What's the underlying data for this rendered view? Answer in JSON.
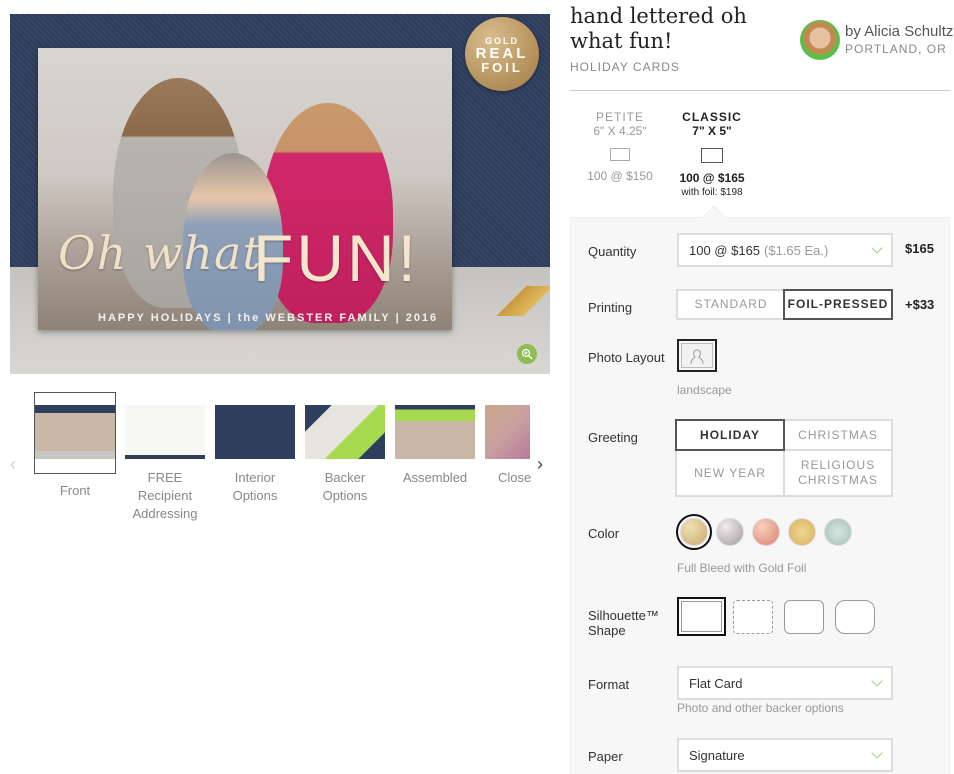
{
  "product": {
    "title": "hand lettered oh what fun!",
    "category": "HOLIDAY CARDS",
    "designer": "by Alicia Schultz",
    "location": "PORTLAND, OR"
  },
  "hero": {
    "badge": [
      "GOLD",
      "REAL",
      "FOIL"
    ],
    "card_script": "Oh what",
    "card_big": "FUN!",
    "card_tagline": "HAPPY HOLIDAYS | the WEBSTER FAMILY | 2016",
    "zoom_icon": "zoom-in-icon"
  },
  "thumbnails": [
    {
      "label": "Front",
      "active": true
    },
    {
      "label": "FREE Recipient Addressing"
    },
    {
      "label": "Interior Options"
    },
    {
      "label": "Backer Options"
    },
    {
      "label": "Assembled"
    },
    {
      "label": "Close"
    }
  ],
  "nav": {
    "prev": "‹",
    "next": "›"
  },
  "sizes": [
    {
      "name": "PETITE",
      "dims": "6\" X 4.25\"",
      "price": "100 @ $150",
      "foil": ""
    },
    {
      "name": "CLASSIC",
      "dims": "7\" X 5\"",
      "price": "100 @ $165",
      "foil": "with foil: $198",
      "selected": true
    }
  ],
  "options": {
    "quantity": {
      "label": "Quantity",
      "value": "100 @ $165",
      "each": "($1.65 Ea.)",
      "price": "$165"
    },
    "printing": {
      "label": "Printing",
      "choices": [
        "STANDARD",
        "FOIL-PRESSED"
      ],
      "selected": "FOIL-PRESSED",
      "price": "+$33"
    },
    "photo_layout": {
      "label": "Photo Layout",
      "hint": "landscape"
    },
    "greeting": {
      "label": "Greeting",
      "choices": [
        "HOLIDAY",
        "CHRISTMAS",
        "NEW YEAR",
        "RELIGIOUS CHRISTMAS"
      ],
      "selected": "HOLIDAY"
    },
    "color": {
      "label": "Color",
      "hint": "Full Bleed with Gold Foil",
      "swatches": [
        {
          "name": "gold",
          "color": "#d8c08a",
          "selected": true
        },
        {
          "name": "silver",
          "color": "#b8b4b6"
        },
        {
          "name": "rose-gold",
          "color": "#e8a08c"
        },
        {
          "name": "gold-glitter",
          "color": "#e2c47a"
        },
        {
          "name": "silver-glitter",
          "color": "#b8cfc6"
        }
      ]
    },
    "shape": {
      "label": "Silhouette™ Shape",
      "label_1": "Silhouette™",
      "label_2": "Shape",
      "choices": [
        "rectangle",
        "scalloped",
        "rounded",
        "ticket"
      ],
      "selected": "rectangle"
    },
    "format": {
      "label": "Format",
      "value": "Flat Card",
      "hint": "Photo and other backer options"
    },
    "paper": {
      "label": "Paper",
      "value": "Signature"
    }
  }
}
